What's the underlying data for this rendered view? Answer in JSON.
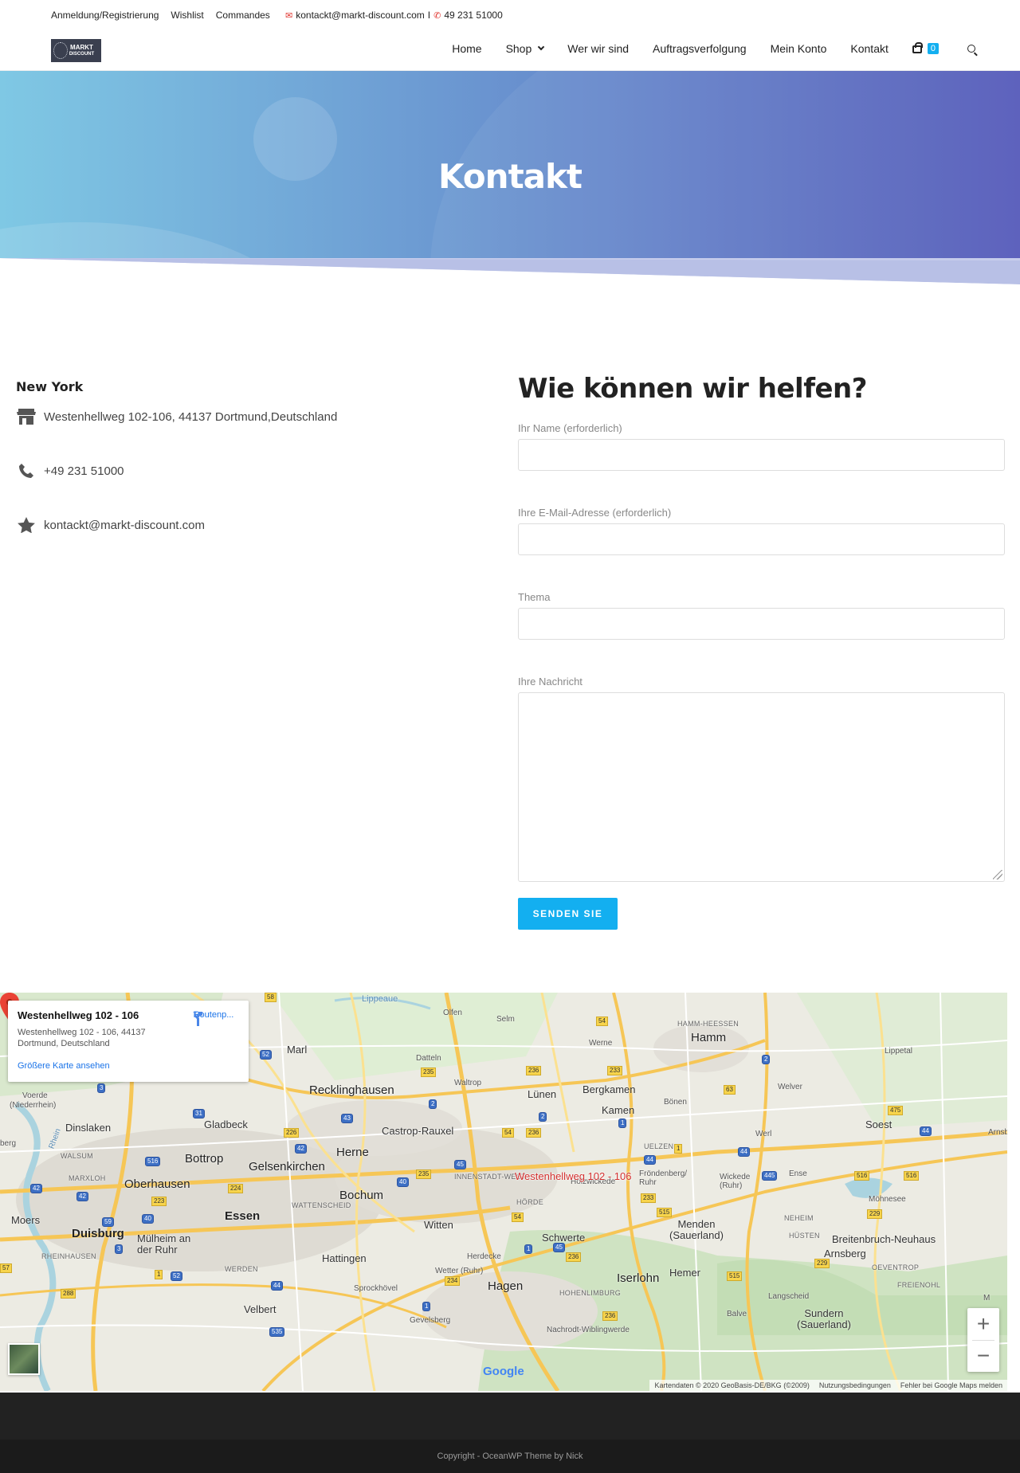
{
  "topbar": {
    "links": [
      "Anmeldung/Registrierung",
      "Wishlist",
      "Commandes"
    ],
    "email": "kontackt@markt-discount.com",
    "separator": "I",
    "phone": "49 231 51000"
  },
  "header": {
    "logo_line1": "MARKT",
    "logo_line2": "DISCOUNT",
    "nav": {
      "home": "Home",
      "shop": "Shop",
      "about": "Wer wir sind",
      "tracking": "Auftragsverfolgung",
      "account": "Mein Konto",
      "contact": "Kontakt"
    },
    "cart_count": "0",
    "accent_color": "#13aff0"
  },
  "hero": {
    "title": "Kontakt",
    "gradient_start": "#7fc8e4",
    "gradient_end": "#5459b9"
  },
  "info": {
    "city": "New York",
    "address": "Westenhellweg 102-106, 44137 Dortmund,Deutschland",
    "phone": "+49 231 51000",
    "email": "kontackt@markt-discount.com",
    "icons": [
      "store-icon",
      "phone-icon",
      "star-icon"
    ]
  },
  "form": {
    "heading": "Wie können wir helfen?",
    "name_label": "Ihr Name (erforderlich)",
    "email_label": "Ihre E-Mail-Adresse (erforderlich)",
    "subject_label": "Thema",
    "message_label": "Ihre Nachricht",
    "submit": "SENDEN SIE"
  },
  "map": {
    "card_title": "Westenhellweg 102 - 106",
    "card_address": "Westenhellweg 102 - 106, 44137 Dortmund, Deutschland",
    "card_link": "Größere Karte ansehen",
    "card_route": "Routenp...",
    "pin_label": "Westenhellweg 102 - 106",
    "places": {
      "lippeaue": "Lippeaue",
      "olfen": "Olfen",
      "selm": "Selm",
      "hamm_heessen": "HAMM-HEESSEN",
      "hamm": "Hamm",
      "werne": "Werne",
      "marl": "Marl",
      "datteln": "Datteln",
      "lippetal": "Lippetal",
      "waltrop": "Waltrop",
      "recklinghausen": "Recklinghausen",
      "bergkamen": "Bergkamen",
      "luenen": "Lünen",
      "welver": "Welver",
      "voerde": "Voerde",
      "niederrhein": "(Niederrhein)",
      "boenen": "Bönen",
      "kamen": "Kamen",
      "dinslaken": "Dinslaken",
      "gladbeck": "Gladbeck",
      "castrop": "Castrop-Rauxel",
      "soest": "Soest",
      "werl": "Werl",
      "rhein": "Rhein",
      "walsum": "WALSUM",
      "bottrop": "Bottrop",
      "herne": "Herne",
      "uelzen": "UELZEN",
      "gelsenkirchen": "Gelsenkirchen",
      "innenstadt": "INNENSTADT-WEST",
      "froendenberg": "Fröndenberg/\nRuhr",
      "wickede": "Wickede\n(Ruhr)",
      "ense": "Ense",
      "marxloh": "MARXLOH",
      "oberhausen": "Oberhausen",
      "holzwickede": "Holzwickede",
      "bochum": "Bochum",
      "watt": "WATTENSCHEID",
      "hoerde": "HÖRDE",
      "moehnesee": "Möhnesee",
      "moers": "Moers",
      "essen": "Essen",
      "witten": "Witten",
      "neheim": "NEHEIM",
      "duisburg": "Duisburg",
      "muelheim": "Mülheim an\nder Ruhr",
      "schwerte": "Schwerte",
      "menden": "Menden\n(Sauerland)",
      "huesten": "HÜSTEN",
      "breitenbruch": "Breitenbruch-Neuhaus",
      "rheinhausen": "RHEINHAUSEN",
      "hattingen": "Hattingen",
      "herdecke": "Herdecke",
      "arnsberg": "Arnsberg",
      "werden": "WERDEN",
      "wetter": "Wetter (Ruhr)",
      "hemer": "Hemer",
      "oeventrop": "OEVENTROP",
      "sprockhoevel": "Sprockhövel",
      "hagen": "Hagen",
      "iserlohn": "Iserlohn",
      "hohenlimburg": "HOHENLIMBURG",
      "freienohl": "FREIENOHL",
      "langscheid": "Langscheid",
      "velbert": "Velbert",
      "balve": "Balve",
      "sundern": "Sundern\n(Sauerland)",
      "gevelsberg": "Gevelsberg",
      "nachrodt": "Nachrodt-Wiblingwerde",
      "berg": "berg",
      "arnsb_edge": "Arnsb",
      "m_edge": "M"
    },
    "google": "Google",
    "attribution": [
      "Kartendaten © 2020 GeoBasis-DE/BKG (©2009)",
      "Nutzungsbedingungen",
      "Fehler bei Google Maps melden"
    ]
  },
  "footer": {
    "copyright": "Copyright - OceanWP Theme by Nick"
  }
}
